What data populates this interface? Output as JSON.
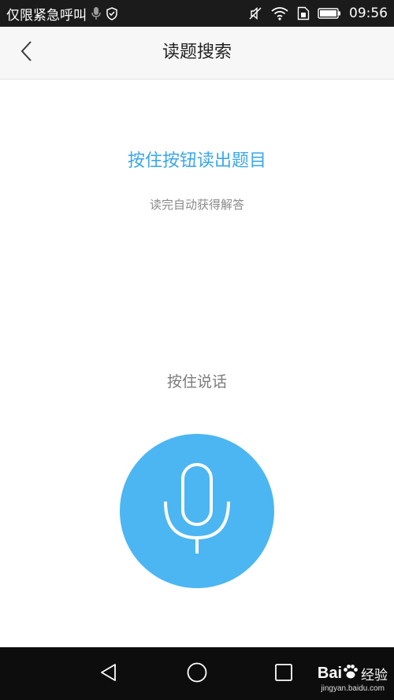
{
  "status_bar": {
    "carrier_text": "仅限紧急呼叫",
    "time": "09:56",
    "icons": [
      "mic-icon",
      "shield-icon",
      "vibrate-mute-icon",
      "wifi-icon",
      "sim-icon",
      "battery-icon"
    ]
  },
  "header": {
    "title": "读题搜索",
    "back_icon": "chevron-left-icon"
  },
  "main": {
    "instruction": "按住按钮读出题目",
    "subtext": "读完自动获得解答",
    "hold_label": "按住说话",
    "mic_icon": "microphone-icon"
  },
  "nav_bar": {
    "icons": [
      "nav-back-icon",
      "nav-home-icon",
      "nav-recents-icon"
    ]
  },
  "watermark": {
    "brand": "Bai",
    "suffix": "经验",
    "domain": "jingyan.baidu.com"
  },
  "colors": {
    "accent": "#3ba7e8",
    "mic_button": "#4cb6f2",
    "status_bar": "#1b1b1b",
    "nav_bar": "#0d0d0d",
    "header_bg": "#f7f7f7"
  }
}
